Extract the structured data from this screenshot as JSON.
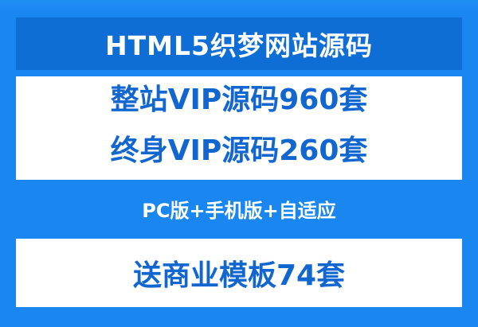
{
  "title": "HTML5织梦网站源码",
  "offers": {
    "line1": "整站VIP源码960套",
    "line2": "终身VIP源码260套"
  },
  "platforms": "PC版+手机版+自适应",
  "bonus": "送商业模板74套",
  "colors": {
    "background": "#1a86f0",
    "title_box": "#0f6ed6",
    "text_blue": "#1266d0",
    "panel": "#ffffff"
  }
}
